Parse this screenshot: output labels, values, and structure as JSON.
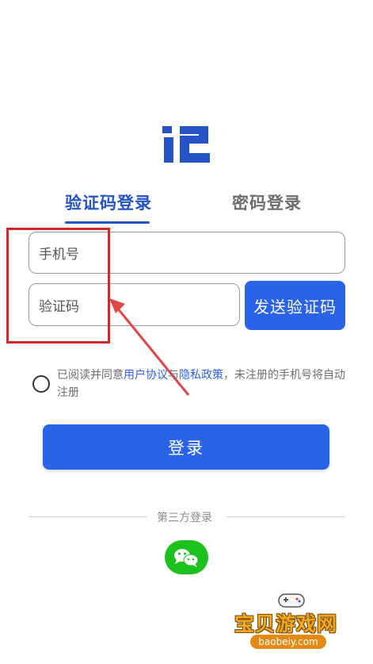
{
  "tabs": {
    "sms_login": "验证码登录",
    "password_login": "密码登录"
  },
  "form": {
    "phone_placeholder": "手机号",
    "code_placeholder": "验证码",
    "send_code_label": "发送验证码"
  },
  "agreement": {
    "prefix": "已阅读并同意",
    "user_agreement": "用户协议",
    "and": "与",
    "privacy_policy": "隐私政策",
    "suffix": "，未注册的手机号将自动注册"
  },
  "login_button": "登录",
  "third_party_label": "第三方登录",
  "watermark": {
    "name": "宝贝游戏网",
    "url": "baobeiy.com"
  },
  "colors": {
    "accent": "#2b63e8",
    "annotation": "#d9262b",
    "wechat": "#1dc11d"
  }
}
